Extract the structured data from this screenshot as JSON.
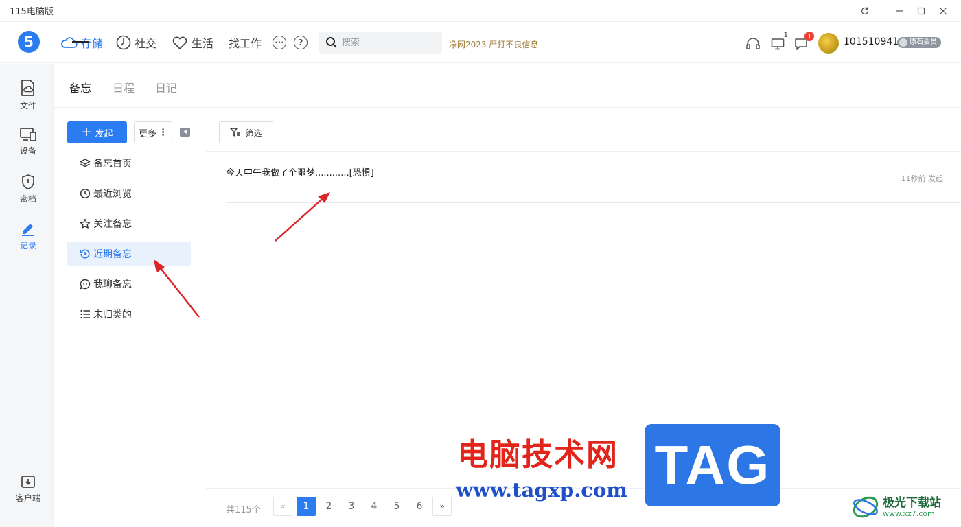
{
  "app": {
    "title": "115电脑版"
  },
  "nav": {
    "storage": "存储",
    "social": "社交",
    "life": "生活",
    "jobs": "找工作",
    "search_placeholder": "搜索",
    "promo": "净网2023 严打不良信息",
    "monitor_count": "1",
    "message_badge": "1",
    "user_id": "101510941",
    "member_label": "原石会员"
  },
  "rail": {
    "files": "文件",
    "devices": "设备",
    "vault": "密档",
    "records": "记录",
    "client": "客户端"
  },
  "tabs": [
    "备忘",
    "日程",
    "日记"
  ],
  "actions": {
    "new_label": "发起",
    "more_label": "更多",
    "filter_label": "筛选"
  },
  "menu": [
    {
      "label": "备忘首页"
    },
    {
      "label": "最近浏览"
    },
    {
      "label": "关注备忘"
    },
    {
      "label": "近期备忘"
    },
    {
      "label": "我聊备忘"
    },
    {
      "label": "未归类的"
    }
  ],
  "memos": [
    {
      "text": "今天中午我做了个噩梦............[恐惧]",
      "meta": "11秒前 发起"
    }
  ],
  "pager": {
    "total": "共115个",
    "prev": "«",
    "next": "»",
    "pages": [
      "1",
      "2",
      "3",
      "4",
      "5",
      "6"
    ],
    "current": "1"
  },
  "watermark": {
    "cn_text": "电脑技术网",
    "url": "www.tagxp.com",
    "tag": "TAG",
    "site_name": "极光下载站",
    "site_url": "www.xz7.com"
  },
  "colors": {
    "accent": "#2b7cf0",
    "annotation_arrow": "#d9262a"
  }
}
